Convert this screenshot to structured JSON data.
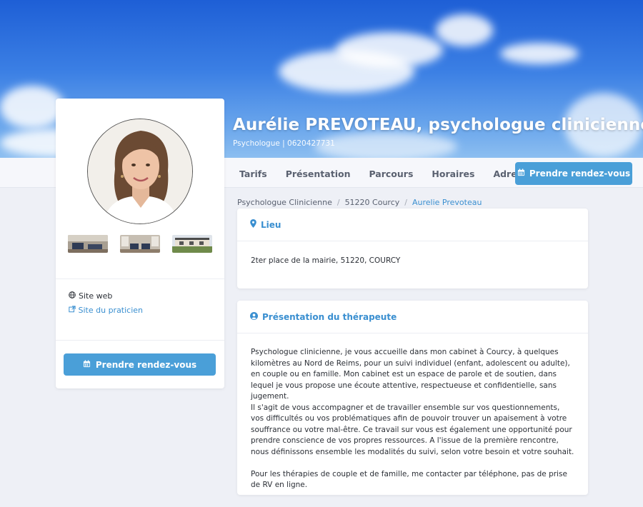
{
  "header": {
    "title": "Aurélie PREVOTEAU, psychologue clinicienne",
    "subtitle": "Psychologue | 0620427731"
  },
  "nav": {
    "items": [
      {
        "label": "Tarifs"
      },
      {
        "label": "Présentation"
      },
      {
        "label": "Parcours"
      },
      {
        "label": "Horaires"
      },
      {
        "label": "Adresse"
      }
    ],
    "cta_label": "Prendre rendez-vous",
    "cta_icon": "calendar-icon"
  },
  "sidebar": {
    "web_label": "Site web",
    "web_link_label": "Site du praticien",
    "cta_label": "Prendre rendez-vous",
    "photos": [
      "office-photo-1",
      "office-photo-2",
      "office-photo-3"
    ]
  },
  "breadcrumb": [
    "Psychologue Clinicienne",
    "51220 Courcy",
    "Aurelie Prevoteau"
  ],
  "lieu": {
    "title": "Lieu",
    "address": "2ter place de la mairie, 51220, COURCY"
  },
  "presentation": {
    "title": "Présentation du thérapeute",
    "paragraph1": "Psychologue clinicienne, je vous accueille dans mon cabinet à Courcy, à quelques kilomètres au Nord de Reims, pour un suivi individuel (enfant, adolescent ou adulte), en couple ou en famille. Mon cabinet est un espace de parole et de soutien, dans lequel je vous propose une écoute attentive, respectueuse et confidentielle, sans jugement.",
    "paragraph2": "Il s'agit de vous accompagner et de travailler ensemble sur vos questionnements, vos difficultés ou vos problématiques afin de pouvoir trouver un apaisement à votre souffrance ou votre mal-être. Ce travail sur vous est également une opportunité pour prendre conscience de vos propres ressources. A l'issue de la première rencontre, nous définissons ensemble les modalités du suivi, selon votre besoin et votre souhait.",
    "paragraph3": "Pour les thérapies de couple et de famille, me contacter par téléphone, pas de prise de RV en ligne."
  },
  "colors": {
    "accent": "#4a9fd8",
    "link": "#3a8fd0",
    "background": "#eef0f6"
  }
}
